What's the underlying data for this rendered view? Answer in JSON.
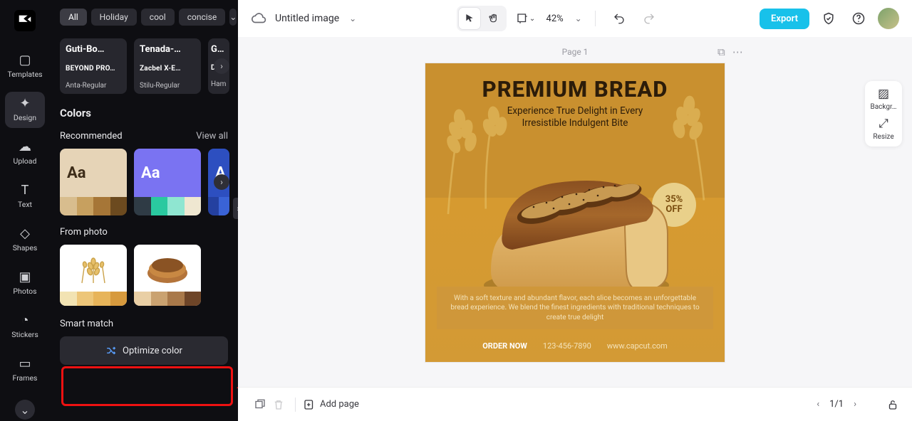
{
  "rail": {
    "items": [
      {
        "label": "Templates"
      },
      {
        "label": "Design"
      },
      {
        "label": "Upload"
      },
      {
        "label": "Text"
      },
      {
        "label": "Shapes"
      },
      {
        "label": "Photos"
      },
      {
        "label": "Stickers"
      },
      {
        "label": "Frames"
      }
    ]
  },
  "panel": {
    "chips": [
      "All",
      "Holiday",
      "cool",
      "concise"
    ],
    "fonts": [
      {
        "l1": "Guti-Bo…",
        "l2": "BEYOND PRO…",
        "l3": "Anta-Regular"
      },
      {
        "l1": "Tenada-…",
        "l2": "Zacbel X-E…",
        "l3": "Stilu-Regular"
      },
      {
        "l1": "G…",
        "l2": "D…",
        "l3": "Ham"
      }
    ],
    "colors_heading": "Colors",
    "recommended": "Recommended",
    "view_all": "View all",
    "from_photo": "From photo",
    "smart_match": "Smart match",
    "optimize": "Optimize color",
    "palettes": {
      "rec": [
        {
          "label": "Aa",
          "top": "#e6d4b7",
          "fg": "#3d2c18",
          "sw": [
            "#d8bd8e",
            "#c7a05f",
            "#a67637",
            "#6c4a1f"
          ]
        },
        {
          "label": "Aa",
          "top": "#7a73f2",
          "fg": "#ffffff",
          "sw": [
            "#2f3b45",
            "#2ac9a0",
            "#8fe6d1",
            "#efe7d1"
          ]
        },
        {
          "label": "A",
          "top": "#2d4fc0",
          "fg": "#ffffff",
          "sw": [
            "#2440a0",
            "#3a63d6"
          ]
        }
      ],
      "photo": [
        {
          "sw": [
            "#f2e3b3",
            "#edc679",
            "#e7b45a",
            "#d79a3e"
          ]
        },
        {
          "sw": [
            "#e9cfa5",
            "#caa270",
            "#a9794a",
            "#6e4528"
          ]
        }
      ]
    }
  },
  "topbar": {
    "title": "Untitled image",
    "zoom": "42%",
    "export": "Export"
  },
  "canvas": {
    "page_label": "Page 1",
    "art": {
      "title": "PREMIUM BREAD",
      "sub_l1": "Experience True Delight in Every",
      "sub_l2": "Irresistible Indulgent Bite",
      "badge_l1": "35%",
      "badge_l2": "OFF",
      "desc": "With a soft texture and abundant flavor, each slice becomes an unforgettable bread experience. We blend the finest ingredients with traditional techniques to create true delight",
      "order": "ORDER NOW",
      "phone": "123-456-7890",
      "url": "www.capcut.com"
    }
  },
  "rtools": {
    "bg": "Backgr…",
    "resize": "Resize"
  },
  "bbar": {
    "add": "Add page",
    "pager": "1/1"
  }
}
